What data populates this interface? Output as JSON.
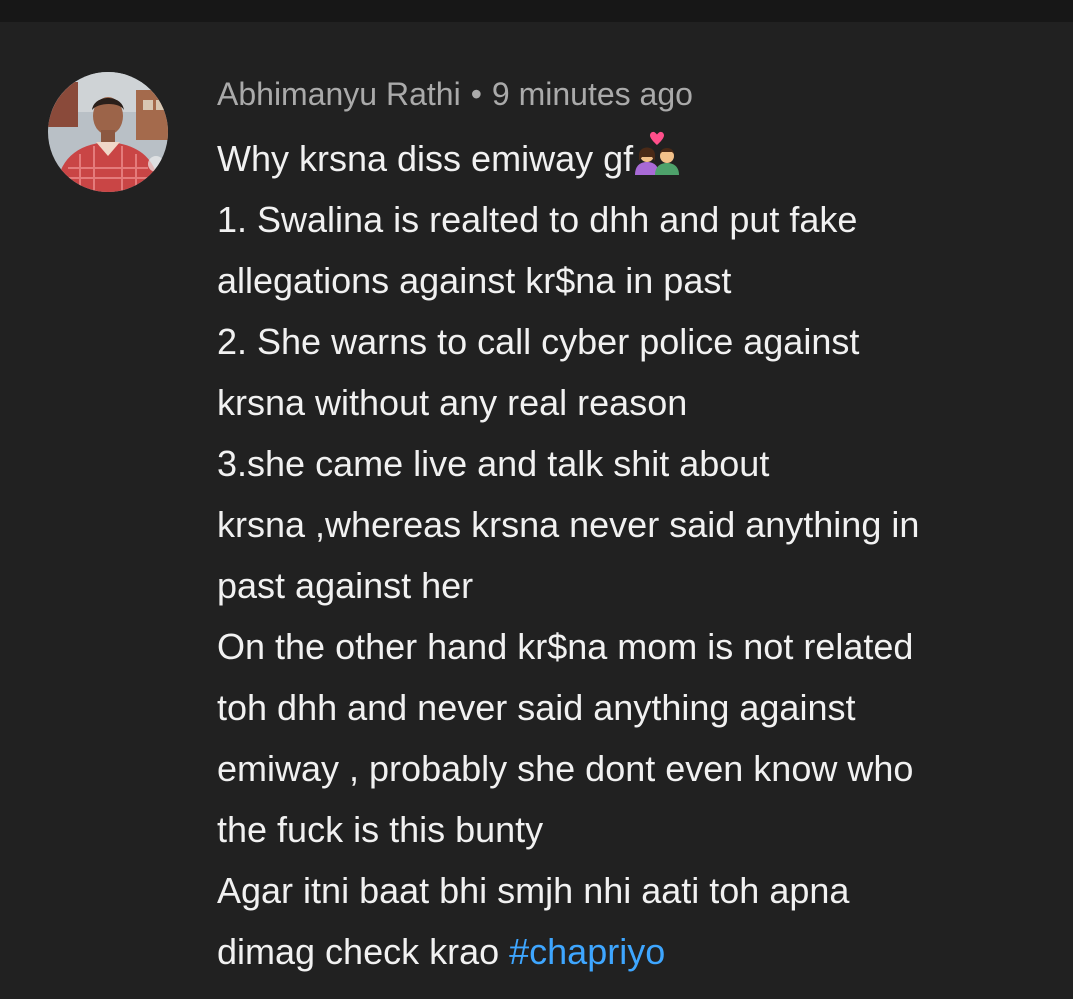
{
  "comment": {
    "author": "Abhimanyu Rathi",
    "separator": "•",
    "timestamp": "9 minutes ago",
    "emoji_name": "couple-with-heart-icon",
    "first_line": "Why krsna diss emiway gf",
    "lines": [
      "1. Swalina is realted to dhh and put fake",
      "allegations against kr$na in past",
      "2. She warns to call cyber police against",
      "krsna without any real reason",
      "3.she came live and talk shit about",
      "krsna ,whereas krsna never said anything in",
      "past against her",
      "On the other hand kr$na mom is not related",
      "toh dhh and never said anything against",
      "emiway , probably she dont even know who",
      "the fuck is this bunty",
      "Agar itni baat bhi smjh nhi aati toh apna"
    ],
    "last_line_text": "dimag check krao ",
    "hashtag": "#chapriyo"
  },
  "colors": {
    "background": "#212121",
    "text": "#f1f1f1",
    "meta": "#aaaaaa",
    "link": "#3ea6ff"
  }
}
